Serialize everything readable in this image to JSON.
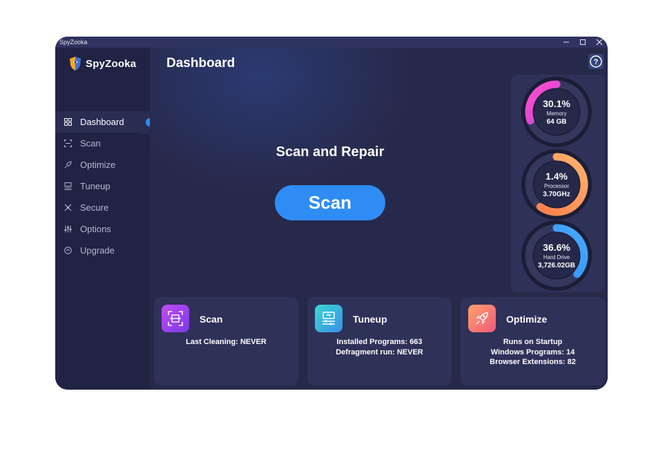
{
  "window": {
    "title": "SpyZooka"
  },
  "brand": {
    "name": "SpyZooka"
  },
  "sidebar": {
    "items": [
      {
        "label": "Dashboard",
        "icon": "dashboard-icon",
        "active": true
      },
      {
        "label": "Scan",
        "icon": "scan-icon"
      },
      {
        "label": "Optimize",
        "icon": "rocket-icon"
      },
      {
        "label": "Tuneup",
        "icon": "tuneup-icon"
      },
      {
        "label": "Secure",
        "icon": "secure-icon"
      },
      {
        "label": "Options",
        "icon": "sliders-icon"
      },
      {
        "label": "Upgrade",
        "icon": "upgrade-icon"
      }
    ]
  },
  "header": {
    "title": "Dashboard",
    "help_label": "?"
  },
  "hero": {
    "title": "Scan and Repair",
    "button_label": "Scan"
  },
  "gauges": [
    {
      "percent": "30.1%",
      "fraction": 0.301,
      "label": "Memory",
      "value": "64 GB",
      "color_from": "#a23cf0",
      "color_to": "#ff4fc8"
    },
    {
      "percent": "1.4%",
      "fraction": 0.6,
      "label": "Processor",
      "value": "3.70GHz",
      "color_from": "#ff7a4a",
      "color_to": "#ffb36a"
    },
    {
      "percent": "36.6%",
      "fraction": 0.366,
      "label": "Hard Drive",
      "value": "3,726.02GB",
      "color_from": "#2f8cf5",
      "color_to": "#46a8ff"
    }
  ],
  "cards": [
    {
      "title": "Scan",
      "icon": "scan-icon",
      "lines": [
        "Last Cleaning: NEVER"
      ]
    },
    {
      "title": "Tuneup",
      "icon": "tuneup-icon",
      "lines": [
        "Installed Programs: 663",
        "Defragment run: NEVER"
      ]
    },
    {
      "title": "Optimize",
      "icon": "rocket-icon",
      "lines": [
        "Runs on Startup",
        "Windows Programs: 14",
        "Browser Extensions: 82"
      ]
    }
  ],
  "colors": {
    "accent": "#2f8cf5",
    "background": "#27294a",
    "sidebar": "#202343",
    "panel": "#2e3158"
  }
}
